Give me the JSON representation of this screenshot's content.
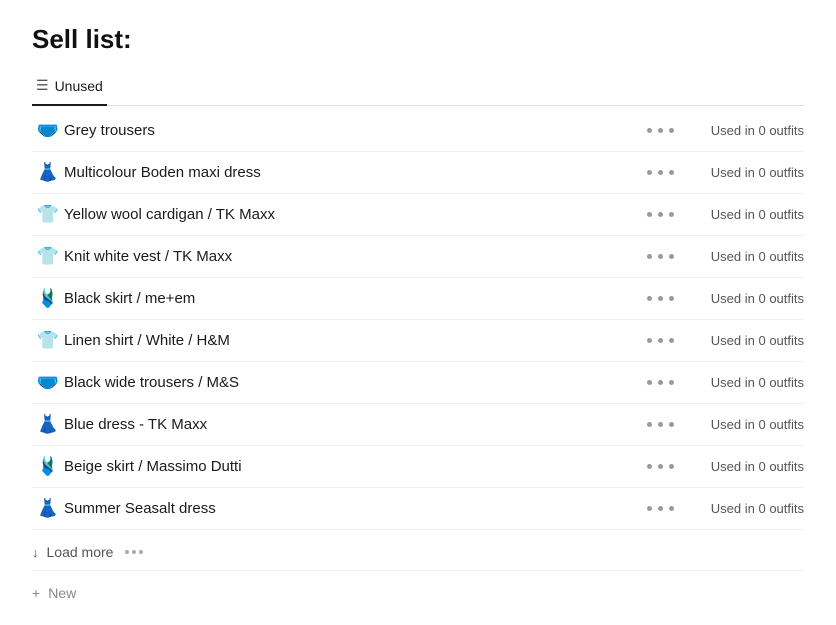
{
  "page": {
    "title": "Sell list:",
    "tab_label": "Unused",
    "tab_icon": "☰",
    "new_label": "New",
    "load_more_label": "Load more"
  },
  "items": [
    {
      "id": 1,
      "icon": "🩲",
      "name": "Grey trousers",
      "status": "Used in 0 outfits"
    },
    {
      "id": 2,
      "icon": "👗",
      "name": "Multicolour Boden maxi dress",
      "status": "Used in 0 outfits"
    },
    {
      "id": 3,
      "icon": "👕",
      "name": "Yellow wool cardigan / TK Maxx",
      "status": "Used in 0 outfits"
    },
    {
      "id": 4,
      "icon": "👕",
      "name": "Knit white vest / TK Maxx",
      "status": "Used in 0 outfits"
    },
    {
      "id": 5,
      "icon": "🩱",
      "name": "Black skirt / me+em",
      "status": "Used in 0 outfits"
    },
    {
      "id": 6,
      "icon": "👕",
      "name": "Linen shirt / White / H&M",
      "status": "Used in 0 outfits"
    },
    {
      "id": 7,
      "icon": "🩲",
      "name": "Black wide trousers / M&S",
      "status": "Used in 0 outfits"
    },
    {
      "id": 8,
      "icon": "👗",
      "name": "Blue dress - TK Maxx",
      "status": "Used in 0 outfits"
    },
    {
      "id": 9,
      "icon": "🩱",
      "name": "Beige skirt / Massimo Dutti",
      "status": "Used in 0 outfits"
    },
    {
      "id": 10,
      "icon": "👗",
      "name": "Summer Seasalt dress",
      "status": "Used in 0 outfits"
    }
  ]
}
